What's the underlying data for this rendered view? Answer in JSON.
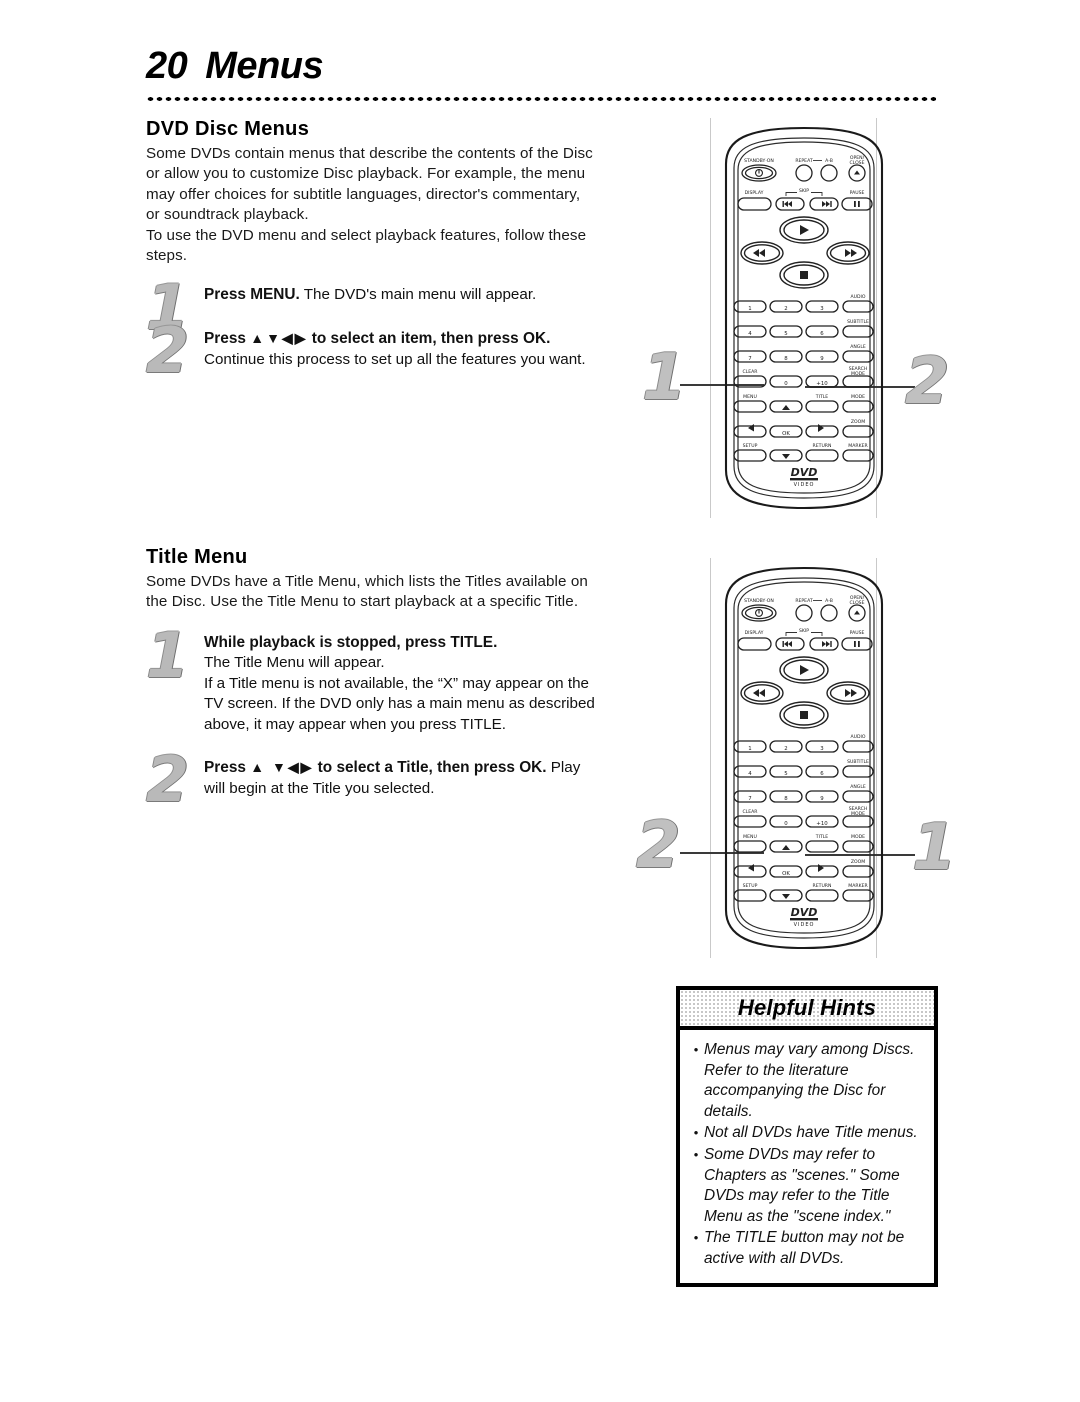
{
  "page": {
    "number": "20",
    "title": "Menus"
  },
  "sections": [
    {
      "heading": "DVD Disc Menus",
      "intro": "Some DVDs contain menus that describe the contents of the Disc or allow you to customize Disc playback. For example, the menu may offer choices for subtitle languages, director's commentary, or soundtrack playback.\nTo use the DVD menu and select playback features, follow these steps.",
      "steps": [
        {
          "number": "1",
          "lead": "Press MENU.",
          "rest": " The DVD's main menu will appear."
        },
        {
          "number": "2",
          "lead_pre": "Press ",
          "lead_arrows": "▲▼◀▶",
          "lead_post": " to select an item, then press OK.",
          "rest": " Continue this process to set up all the features you want."
        }
      ]
    },
    {
      "heading": "Title Menu",
      "intro": "Some DVDs have a Title Menu, which lists the Titles available on the Disc. Use the Title Menu to start playback at a specific Title.",
      "steps": [
        {
          "number": "1",
          "lead": "While playback is stopped, press TITLE.",
          "rest": "The Title Menu will appear.\nIf a Title menu is not available, the “X” may appear on the TV screen. If the DVD only has a main menu as described above, it may appear when you press TITLE."
        },
        {
          "number": "2",
          "lead_pre": "Press ",
          "lead_arrows": "▲ ▼◀▶",
          "lead_post": " to select a Title, then press OK.",
          "rest": " Play will begin at the Title you selected."
        }
      ]
    }
  ],
  "remote": {
    "labels": {
      "standby": "STANDBY·ON",
      "repeat": "REPEAT",
      "repeat_ab": "A-B",
      "open_close_1": "OPEN/",
      "open_close_2": "CLOSE",
      "display": "DISPLAY",
      "skip": "SKIP",
      "pause": "PAUSE",
      "audio": "AUDIO",
      "subtitle": "SUBTITLE",
      "angle": "ANGLE",
      "search_1": "SEARCH",
      "search_2": "MODE",
      "clear": "CLEAR",
      "menu": "MENU",
      "title": "TITLE",
      "mode": "MODE",
      "zoom": "ZOOM",
      "setup": "SETUP",
      "return": "RETURN",
      "marker": "MARKER",
      "ok": "OK",
      "logo_1": "DVD",
      "logo_2": "VIDEO"
    },
    "keys": [
      "1",
      "2",
      "3",
      "4",
      "5",
      "6",
      "7",
      "8",
      "9",
      "0",
      "+10"
    ],
    "figure_1_callouts": {
      "left": "1",
      "right": "2"
    },
    "figure_2_callouts": {
      "left": "2",
      "right": "1"
    }
  },
  "helpful_hints": {
    "title": "Helpful Hints",
    "bullet": "•",
    "items": [
      "Menus may vary among Discs. Refer to the literature accompanying the Disc for details.",
      "Not all DVDs have Title menus.",
      "Some DVDs may refer to Chapters as \"scenes.\" Some DVDs may refer to the Title Menu as the \"scene index.\"",
      "The TITLE button may not be active with all DVDs."
    ]
  }
}
